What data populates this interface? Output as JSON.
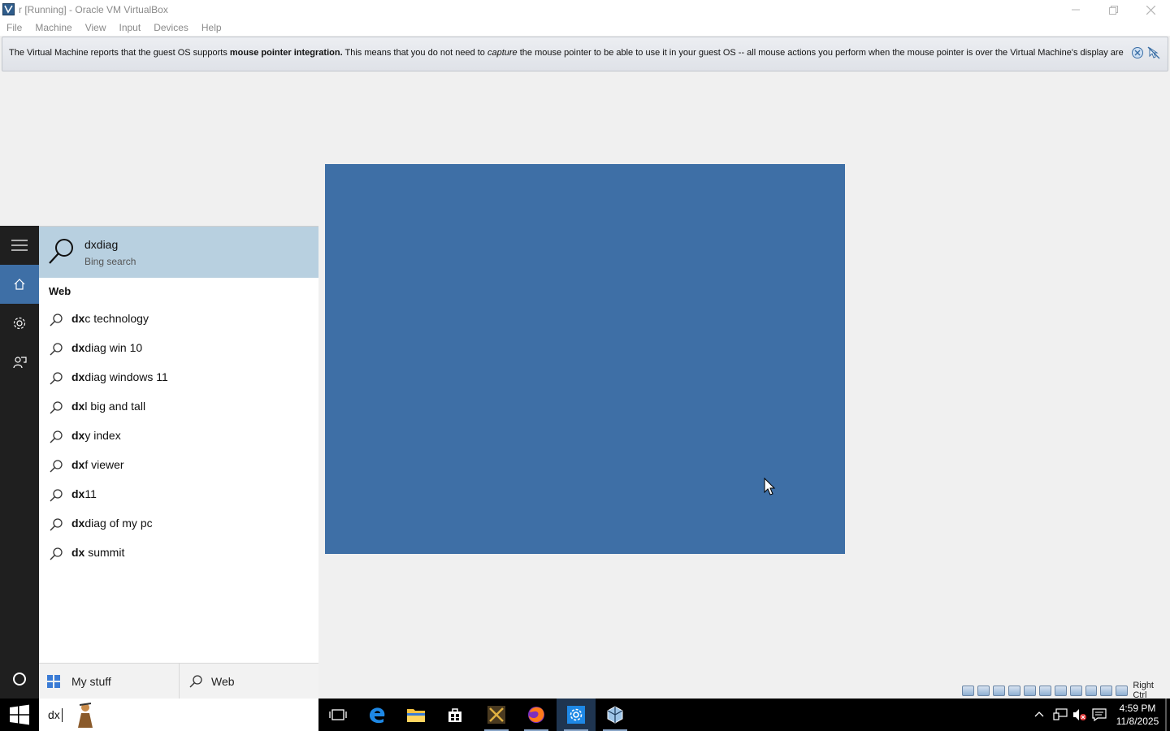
{
  "window": {
    "title": "r [Running] - Oracle VM VirtualBox"
  },
  "menu": [
    "File",
    "Machine",
    "View",
    "Input",
    "Devices",
    "Help"
  ],
  "notification": {
    "part1": "The Virtual Machine reports that the guest OS supports ",
    "bold": "mouse pointer integration.",
    "part2": " This means that you do not need to ",
    "italic": "capture",
    "part3": " the mouse pointer to be able to use it in your guest OS -- all mouse actions you perform when the mouse pointer is over the Virtual Machine's display are"
  },
  "search": {
    "top_result": {
      "title": "dxdiag",
      "subtitle": "Bing search"
    },
    "web_header": "Web",
    "suggestions": [
      {
        "bold": "dx",
        "rest": "c technology"
      },
      {
        "bold": "dx",
        "rest": "diag win 10"
      },
      {
        "bold": "dx",
        "rest": "diag windows 11"
      },
      {
        "bold": "dx",
        "rest": "l big and tall"
      },
      {
        "bold": "dx",
        "rest": "y index"
      },
      {
        "bold": "dx",
        "rest": "f viewer"
      },
      {
        "bold": "dx",
        "rest": "11"
      },
      {
        "bold": "dx",
        "rest": "diag of my pc"
      },
      {
        "bold": "dx",
        "rest": " summit"
      }
    ],
    "scope_mystuff": "My stuff",
    "scope_web": "Web",
    "query": "dx"
  },
  "tray": {
    "time": "4:59 PM",
    "date": "11/8/2025"
  },
  "statusbar": {
    "host_key": "Right Ctrl"
  },
  "colors": {
    "guest_desktop": "#3e6fa6",
    "top_result_bg": "#b8d0e0",
    "rail_bg": "#1f1f1f"
  }
}
